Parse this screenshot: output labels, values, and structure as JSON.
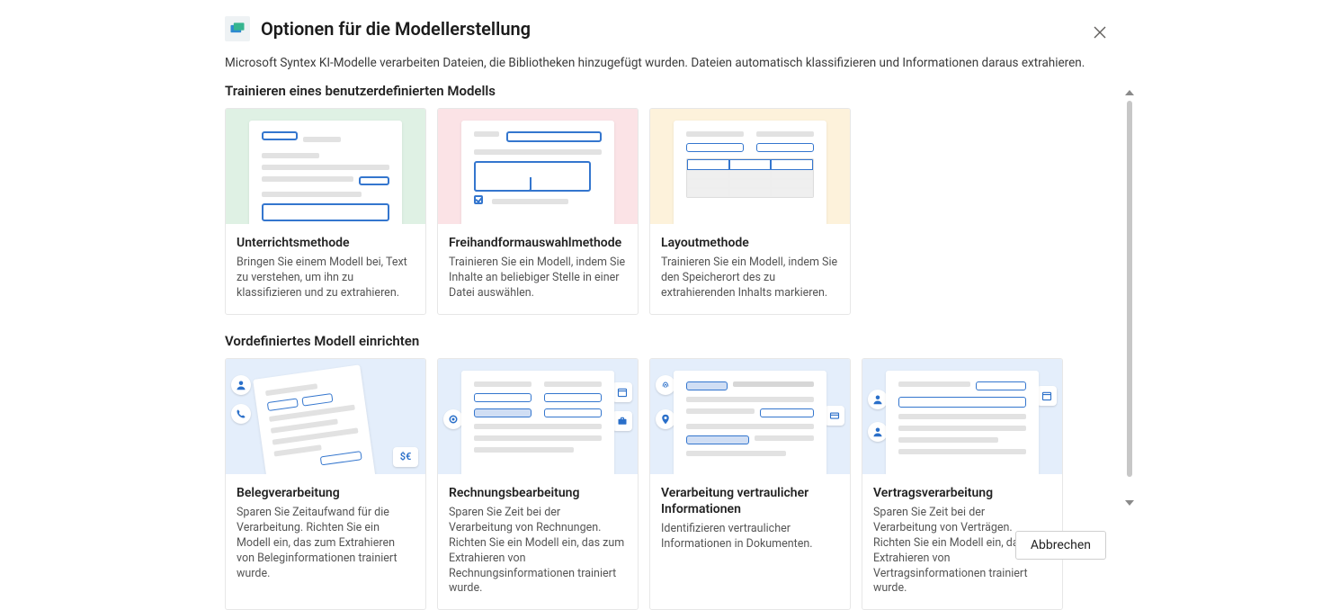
{
  "dialog": {
    "title": "Optionen für die Modellerstellung",
    "subtitle": "Microsoft Syntex KI-Modelle verarbeiten Dateien, die Bibliotheken hinzugefügt wurden. Dateien automatisch klassifizieren und Informationen daraus extrahieren."
  },
  "sections": {
    "custom": {
      "heading": "Trainieren eines benutzerdefinierten Modells",
      "cards": [
        {
          "title": "Unterrichtsmethode",
          "desc": "Bringen Sie einem Modell bei, Text zu verstehen, um ihn zu klassifizieren und zu extrahieren."
        },
        {
          "title": "Freihandformauswahlmethode",
          "desc": "Trainieren Sie ein Modell, indem Sie Inhalte an beliebiger Stelle in einer Datei auswählen."
        },
        {
          "title": "Layoutmethode",
          "desc": "Trainieren Sie ein Modell, indem Sie den Speicherort des zu extrahierenden Inhalts markieren."
        }
      ]
    },
    "prebuilt": {
      "heading": "Vordefiniertes Modell einrichten",
      "cards": [
        {
          "title": "Belegverarbeitung",
          "desc": "Sparen Sie Zeitaufwand für die Verarbeitung. Richten Sie ein Modell ein, das zum Extrahieren von Beleginformationen trainiert wurde."
        },
        {
          "title": "Rechnungsbearbeitung",
          "desc": "Sparen Sie Zeit bei der Verarbeitung von Rechnungen. Richten Sie ein Modell ein, das zum Extrahieren von Rechnungsinformationen trainiert wurde."
        },
        {
          "title": "Verarbeitung vertraulicher Informationen",
          "desc": "Identifizieren vertraulicher Informationen in Dokumenten."
        },
        {
          "title": "Vertragsverarbeitung",
          "desc": "Sparen Sie Zeit bei der Verarbeitung von Verträgen. Richten Sie ein Modell ein, das zum Extrahieren von Vertragsinformationen trainiert wurde."
        }
      ]
    }
  },
  "footer": {
    "cancel": "Abbrechen"
  },
  "badges": {
    "currency": "$€"
  }
}
